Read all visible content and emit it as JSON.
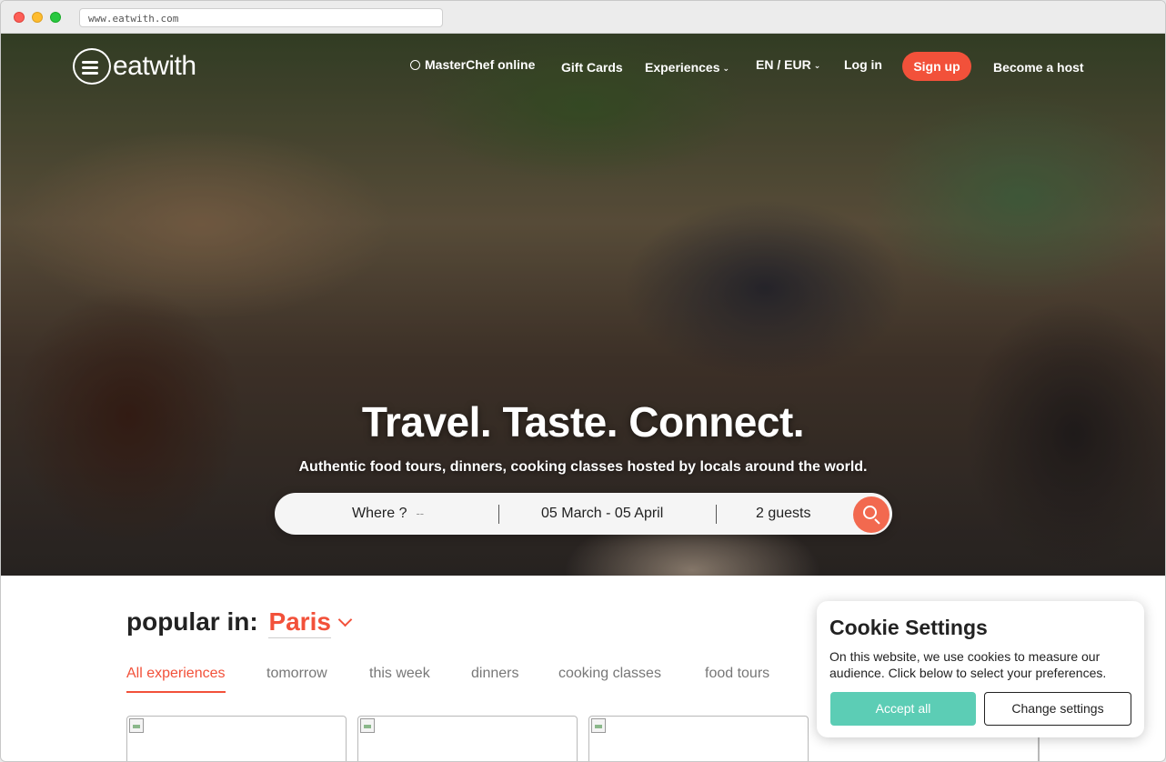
{
  "browser": {
    "url": "www.eatwith.com"
  },
  "header": {
    "logo_text": "eatwith",
    "nav": {
      "masterchef": "MasterChef online",
      "gift_cards": "Gift Cards",
      "experiences": "Experiences",
      "locale": "EN / EUR",
      "login": "Log in",
      "signup": "Sign up",
      "become_host": "Become a host"
    }
  },
  "hero": {
    "headline": "Travel. Taste. Connect.",
    "subline": "Authentic food tours, dinners, cooking classes hosted by locals around the world."
  },
  "search": {
    "where_label": "Where ?",
    "where_placeholder": "--",
    "dates": "05 March - 05 April",
    "guests": "2 guests"
  },
  "popular": {
    "prefix": "popular in:",
    "city": "Paris",
    "tabs": [
      {
        "label": "All experiences",
        "active": true
      },
      {
        "label": "tomorrow",
        "active": false
      },
      {
        "label": "this week",
        "active": false
      },
      {
        "label": "dinners",
        "active": false
      },
      {
        "label": "cooking classes",
        "active": false
      },
      {
        "label": "food tours",
        "active": false
      }
    ]
  },
  "cookie": {
    "title": "Cookie Settings",
    "text": "On this website, we use cookies to measure our audience. Click below to select your preferences.",
    "accept": "Accept all",
    "change": "Change settings"
  },
  "colors": {
    "accent": "#f2513a",
    "accept_button": "#5ccdb5"
  }
}
